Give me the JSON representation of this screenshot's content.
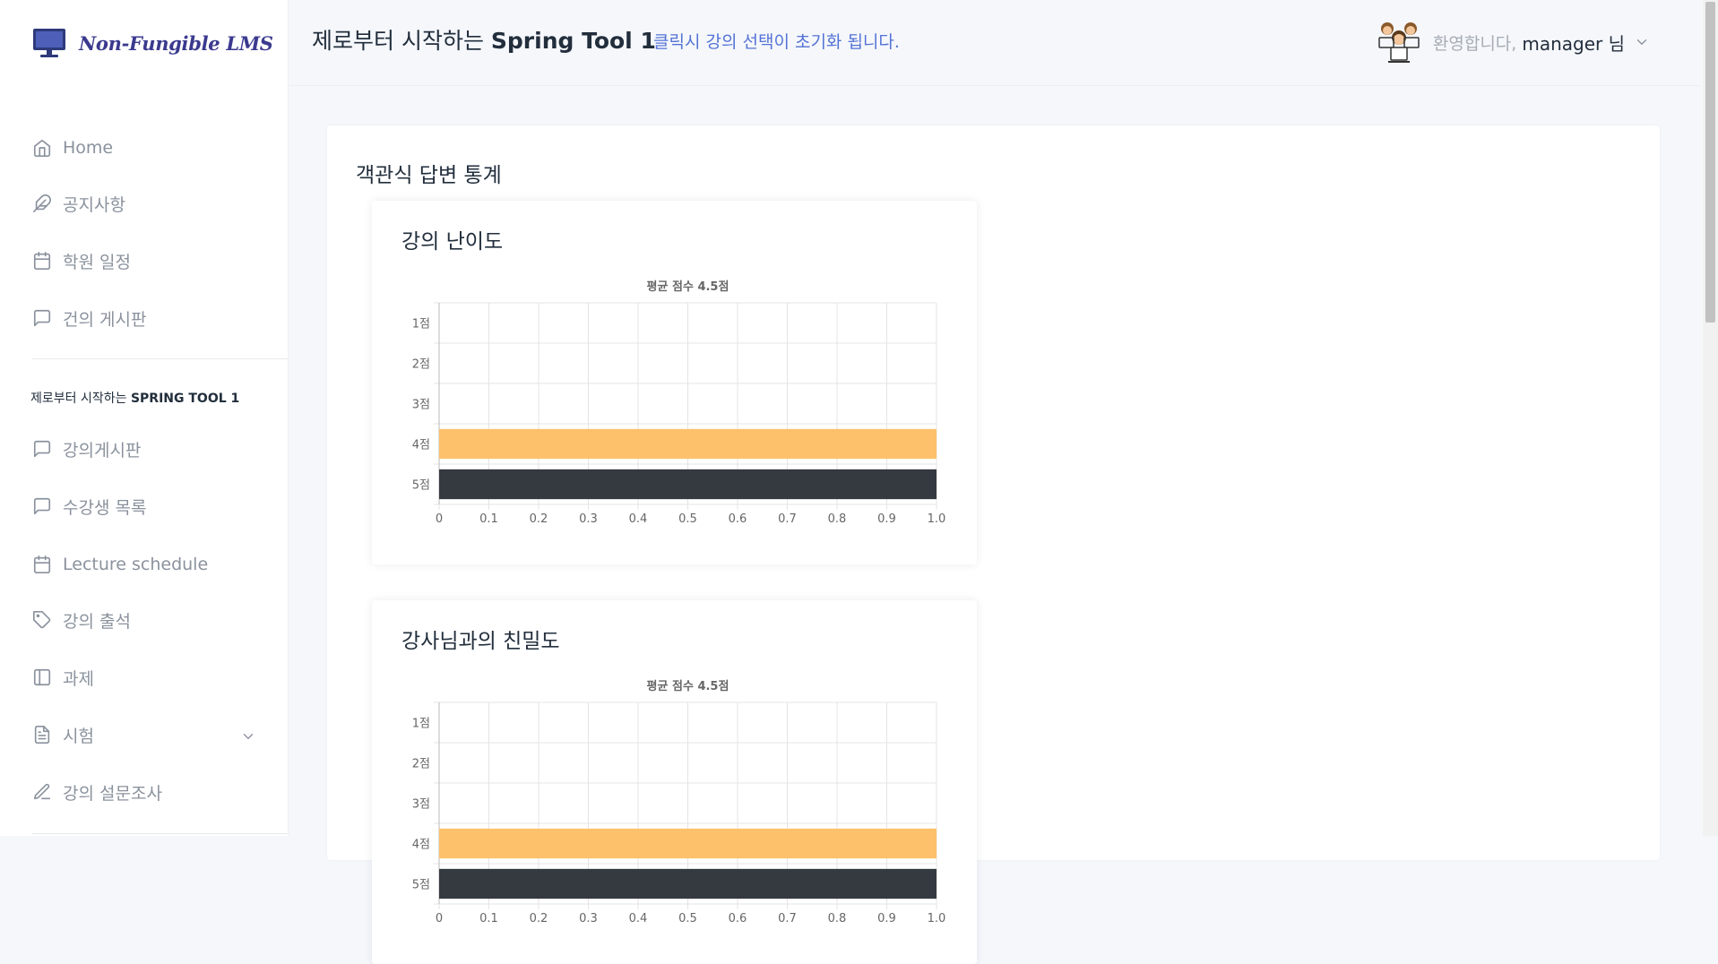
{
  "brand": {
    "name": "Non-Fungible LMS"
  },
  "sidebar": {
    "items": [
      {
        "label": "Home",
        "icon": "home-icon"
      },
      {
        "label": "공지사항",
        "icon": "feather-icon"
      },
      {
        "label": "학원 일정",
        "icon": "calendar-icon"
      },
      {
        "label": "건의 게시판",
        "icon": "message-square-icon"
      }
    ],
    "section": {
      "prefix": "제로부터 시작하는 ",
      "name": "SPRING TOOL 1"
    },
    "course_items": [
      {
        "label": "강의게시판",
        "icon": "message-square-icon"
      },
      {
        "label": "수강생 목록",
        "icon": "message-square-icon"
      },
      {
        "label": "Lecture schedule",
        "icon": "calendar-icon"
      },
      {
        "label": "강의 출석",
        "icon": "tag-icon"
      },
      {
        "label": "과제",
        "icon": "sidebar-icon"
      },
      {
        "label": "시험",
        "icon": "file-text-icon"
      },
      {
        "label": "강의 설문조사",
        "icon": "edit-icon"
      }
    ]
  },
  "header": {
    "title_prefix": "제로부터 시작하는 ",
    "title_course": "Spring Tool 1",
    "hint": "클릭시 강의 선택이 초기화 됩니다.",
    "welcome": "환영합니다,",
    "username": "manager 님"
  },
  "main": {
    "section_title": "객관식 답변 통계"
  },
  "colors": {
    "bar_4": "#fdc16b",
    "bar_5": "#353a41",
    "accent": "#5573d6"
  },
  "chart_data": [
    {
      "type": "bar",
      "orientation": "horizontal",
      "card_title": "강의 난이도",
      "title": "평균 점수 4.5점",
      "categories": [
        "1점",
        "2점",
        "3점",
        "4점",
        "5점"
      ],
      "values": [
        0,
        0,
        0,
        1,
        1
      ],
      "xlim": [
        0,
        1.0
      ],
      "xticks": [
        "0",
        "0.1",
        "0.2",
        "0.3",
        "0.4",
        "0.5",
        "0.6",
        "0.7",
        "0.8",
        "0.9",
        "1.0"
      ],
      "grid": true,
      "legend": "none"
    },
    {
      "type": "bar",
      "orientation": "horizontal",
      "card_title": "강사님과의 친밀도",
      "title": "평균 점수 4.5점",
      "categories": [
        "1점",
        "2점",
        "3점",
        "4점",
        "5점"
      ],
      "values": [
        0,
        0,
        0,
        1,
        1
      ],
      "xlim": [
        0,
        1.0
      ],
      "xticks": [
        "0",
        "0.1",
        "0.2",
        "0.3",
        "0.4",
        "0.5",
        "0.6",
        "0.7",
        "0.8",
        "0.9",
        "1.0"
      ],
      "grid": true,
      "legend": "none"
    }
  ]
}
